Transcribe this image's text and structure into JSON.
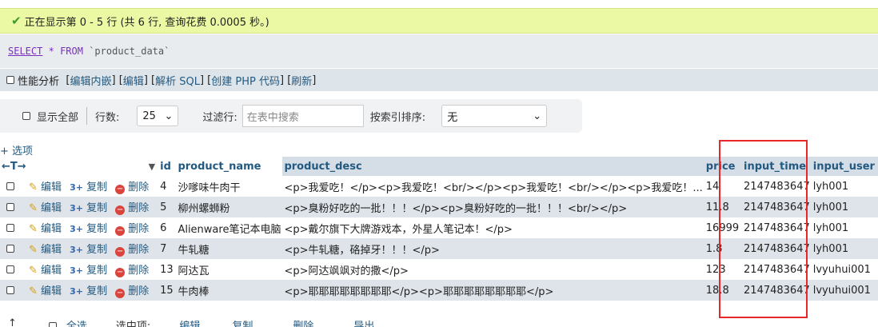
{
  "status": {
    "message": "正在显示第 0 - 5 行 (共 6 行, 查询花费 0.0005 秒。)"
  },
  "sql": {
    "select": "SELECT",
    "star": "*",
    "from": "FROM",
    "table": "`product_data`"
  },
  "tools": {
    "profiling": "性能分析",
    "links": [
      "编辑内嵌",
      "编辑",
      "解析 SQL",
      "创建 PHP 代码",
      "刷新"
    ]
  },
  "nav": {
    "show_all": "显示全部",
    "rows_label": "行数:",
    "rows_value": "25",
    "filter_label": "过滤行:",
    "filter_placeholder": "在表中搜索",
    "sort_label": "按索引排序:",
    "sort_value": "无"
  },
  "options_label": "+ 选项",
  "columns": [
    "id",
    "product_name",
    "product_desc",
    "price",
    "input_time",
    "input_user"
  ],
  "actions": {
    "edit": "编辑",
    "copy": "复制",
    "delete": "删除"
  },
  "rows": [
    {
      "id": "4",
      "product_name": "沙嗲味牛肉干",
      "product_desc": "<p>我爱吃！</p><p>我爱吃！<br/></p><p>我爱吃！<br/></p><p>我爱吃！...",
      "price": "14",
      "input_time": "2147483647",
      "input_user": "lyh001"
    },
    {
      "id": "5",
      "product_name": "柳州螺蛳粉",
      "product_desc": "<p>臭粉好吃的一批！！！</p><p>臭粉好吃的一批！！！<br/></p>",
      "price": "11.8",
      "input_time": "2147483647",
      "input_user": "lyh001"
    },
    {
      "id": "6",
      "product_name": "Alienware笔记本电脑",
      "product_desc": "<p>戴尔旗下大牌游戏本，外星人笔记本！</p>",
      "price": "16999",
      "input_time": "2147483647",
      "input_user": "lyh001"
    },
    {
      "id": "7",
      "product_name": "牛轧糖",
      "product_desc": "<p>牛轧糖，硌掉牙！！！</p>",
      "price": "1.8",
      "input_time": "2147483647",
      "input_user": "lyh001"
    },
    {
      "id": "13",
      "product_name": "阿达瓦",
      "product_desc": "<p>阿达飒飒对的撒</p>",
      "price": "123",
      "input_time": "2147483647",
      "input_user": "lvyuhui001"
    },
    {
      "id": "15",
      "product_name": "牛肉棒",
      "product_desc": "<p>耶耶耶耶耶耶耶耶</p><p>耶耶耶耶耶耶耶耶</p>",
      "price": "18.8",
      "input_time": "2147483647",
      "input_user": "lvyuhui001"
    }
  ],
  "bottom": {
    "select_all": "全选",
    "with_selected": "选中项:",
    "edit": "编辑",
    "copy": "复制",
    "delete": "删除",
    "export": "导出"
  }
}
